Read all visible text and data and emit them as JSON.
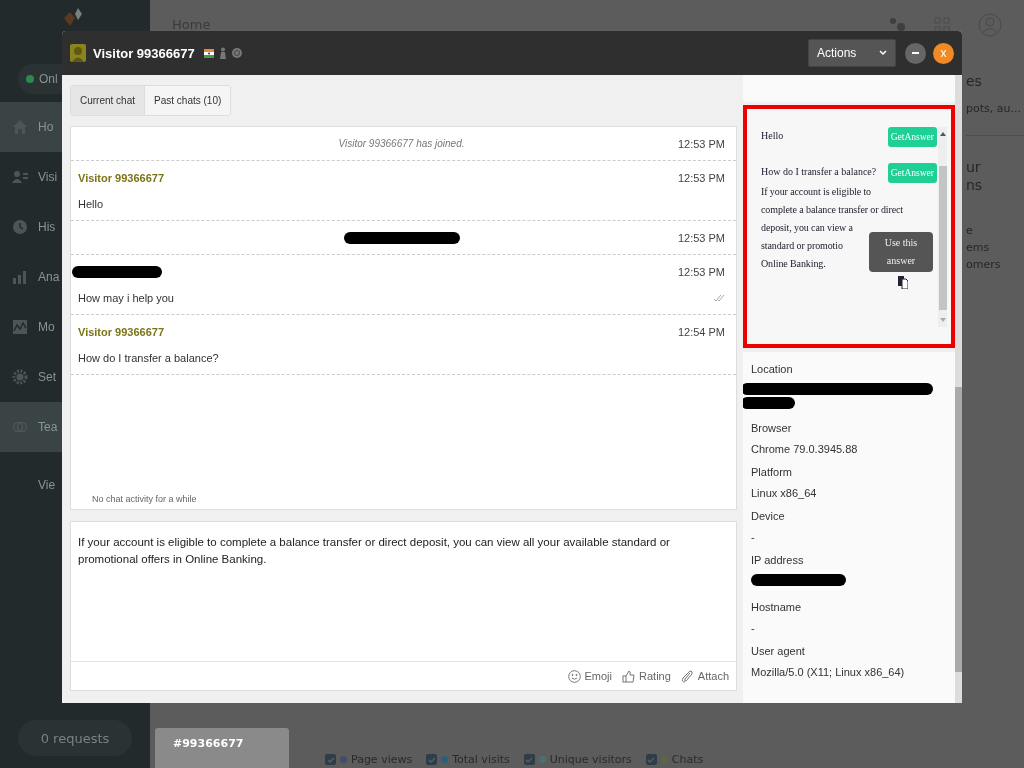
{
  "background": {
    "sidebar": {
      "status": "Onl",
      "items": [
        {
          "kind": "home",
          "label": "Ho",
          "selected": true
        },
        {
          "kind": "visitors",
          "label": "Visi",
          "selected": false
        },
        {
          "kind": "history",
          "label": "His",
          "selected": false
        },
        {
          "kind": "analytics",
          "label": "Ana",
          "selected": false
        },
        {
          "kind": "monitor",
          "label": "Mo",
          "selected": false
        },
        {
          "kind": "settings",
          "label": "Set",
          "selected": false
        },
        {
          "kind": "team",
          "label": "Tea",
          "selected": true
        }
      ],
      "extra_link": "Vie",
      "requests": "0 requests"
    },
    "header": {
      "title": "Home"
    },
    "right_fragments": [
      {
        "kind": "heading",
        "text": "es"
      },
      {
        "kind": "line",
        "text": "pots, au..."
      },
      {
        "kind": "rule"
      },
      {
        "kind": "heading",
        "text": "ur"
      },
      {
        "kind": "heading",
        "text": "ns"
      },
      {
        "kind": "gap"
      },
      {
        "kind": "line",
        "text": "e"
      },
      {
        "kind": "line",
        "text": "ems"
      },
      {
        "kind": "line",
        "text": "omers"
      }
    ],
    "bottom_tab": "#99366677",
    "legend": [
      {
        "label": "Page views",
        "checked": true,
        "color": "#454c66"
      },
      {
        "label": "Total visits",
        "checked": true,
        "color": "#2e5f78"
      },
      {
        "label": "Unique visitors",
        "checked": true,
        "color": "#4c6f74"
      },
      {
        "label": "Chats",
        "checked": true,
        "color": "#5d6640"
      }
    ]
  },
  "chat_window": {
    "title": "Visitor 99366677",
    "actions": "Actions",
    "close": "x",
    "tabs": [
      {
        "label": "Current chat",
        "selected": true
      },
      {
        "label": "Past chats (10)",
        "selected": false
      }
    ],
    "messages": [
      {
        "kind": "system",
        "text": "Visitor 99366677 has joined.",
        "time": "12:53 PM"
      },
      {
        "kind": "visitor",
        "author": "Visitor 99366677",
        "text": "Hello",
        "time": "12:53 PM"
      },
      {
        "kind": "system_redacted",
        "time": "12:53 PM"
      },
      {
        "kind": "operator_redacted",
        "text": "How may i help you",
        "time": "12:53 PM",
        "read": true
      },
      {
        "kind": "visitor",
        "author": "Visitor 99366677",
        "text": "How do I transfer a balance?",
        "time": "12:54 PM"
      }
    ],
    "idle_note": "No chat activity for a while",
    "draft": "If your account is eligible to complete a balance transfer or direct deposit, you can view all your available standard or promotional offers in Online Banking.",
    "compose_tools": [
      {
        "kind": "emoji",
        "label": "Emoji"
      },
      {
        "kind": "rating",
        "label": "Rating"
      },
      {
        "kind": "attach",
        "label": "Attach"
      }
    ],
    "suggestions": {
      "items": [
        {
          "question": "Hello",
          "button": "GetAnswer"
        },
        {
          "question": "How do I transfer a balance?",
          "button": "GetAnswer",
          "answer_lines": [
            "If your account is eligible to",
            "complete a balance transfer or direct",
            "deposit, you can view a",
            "standard or promotio",
            "Online Banking."
          ]
        }
      ],
      "tooltip": "Use this answer"
    },
    "visitor_info": [
      {
        "label": "Location",
        "kind": "redacted"
      },
      {
        "label": "Browser",
        "kind": "text",
        "value": "Chrome 79.0.3945.88"
      },
      {
        "label": "Platform",
        "kind": "text",
        "value": "Linux x86_64"
      },
      {
        "label": "Device",
        "kind": "text",
        "value": "-"
      },
      {
        "label": "IP address",
        "kind": "redacted"
      },
      {
        "label": "Hostname",
        "kind": "text",
        "value": "-"
      },
      {
        "label": "User agent",
        "kind": "text",
        "value": "Mozilla/5.0 (X11; Linux x86_64)"
      }
    ]
  }
}
